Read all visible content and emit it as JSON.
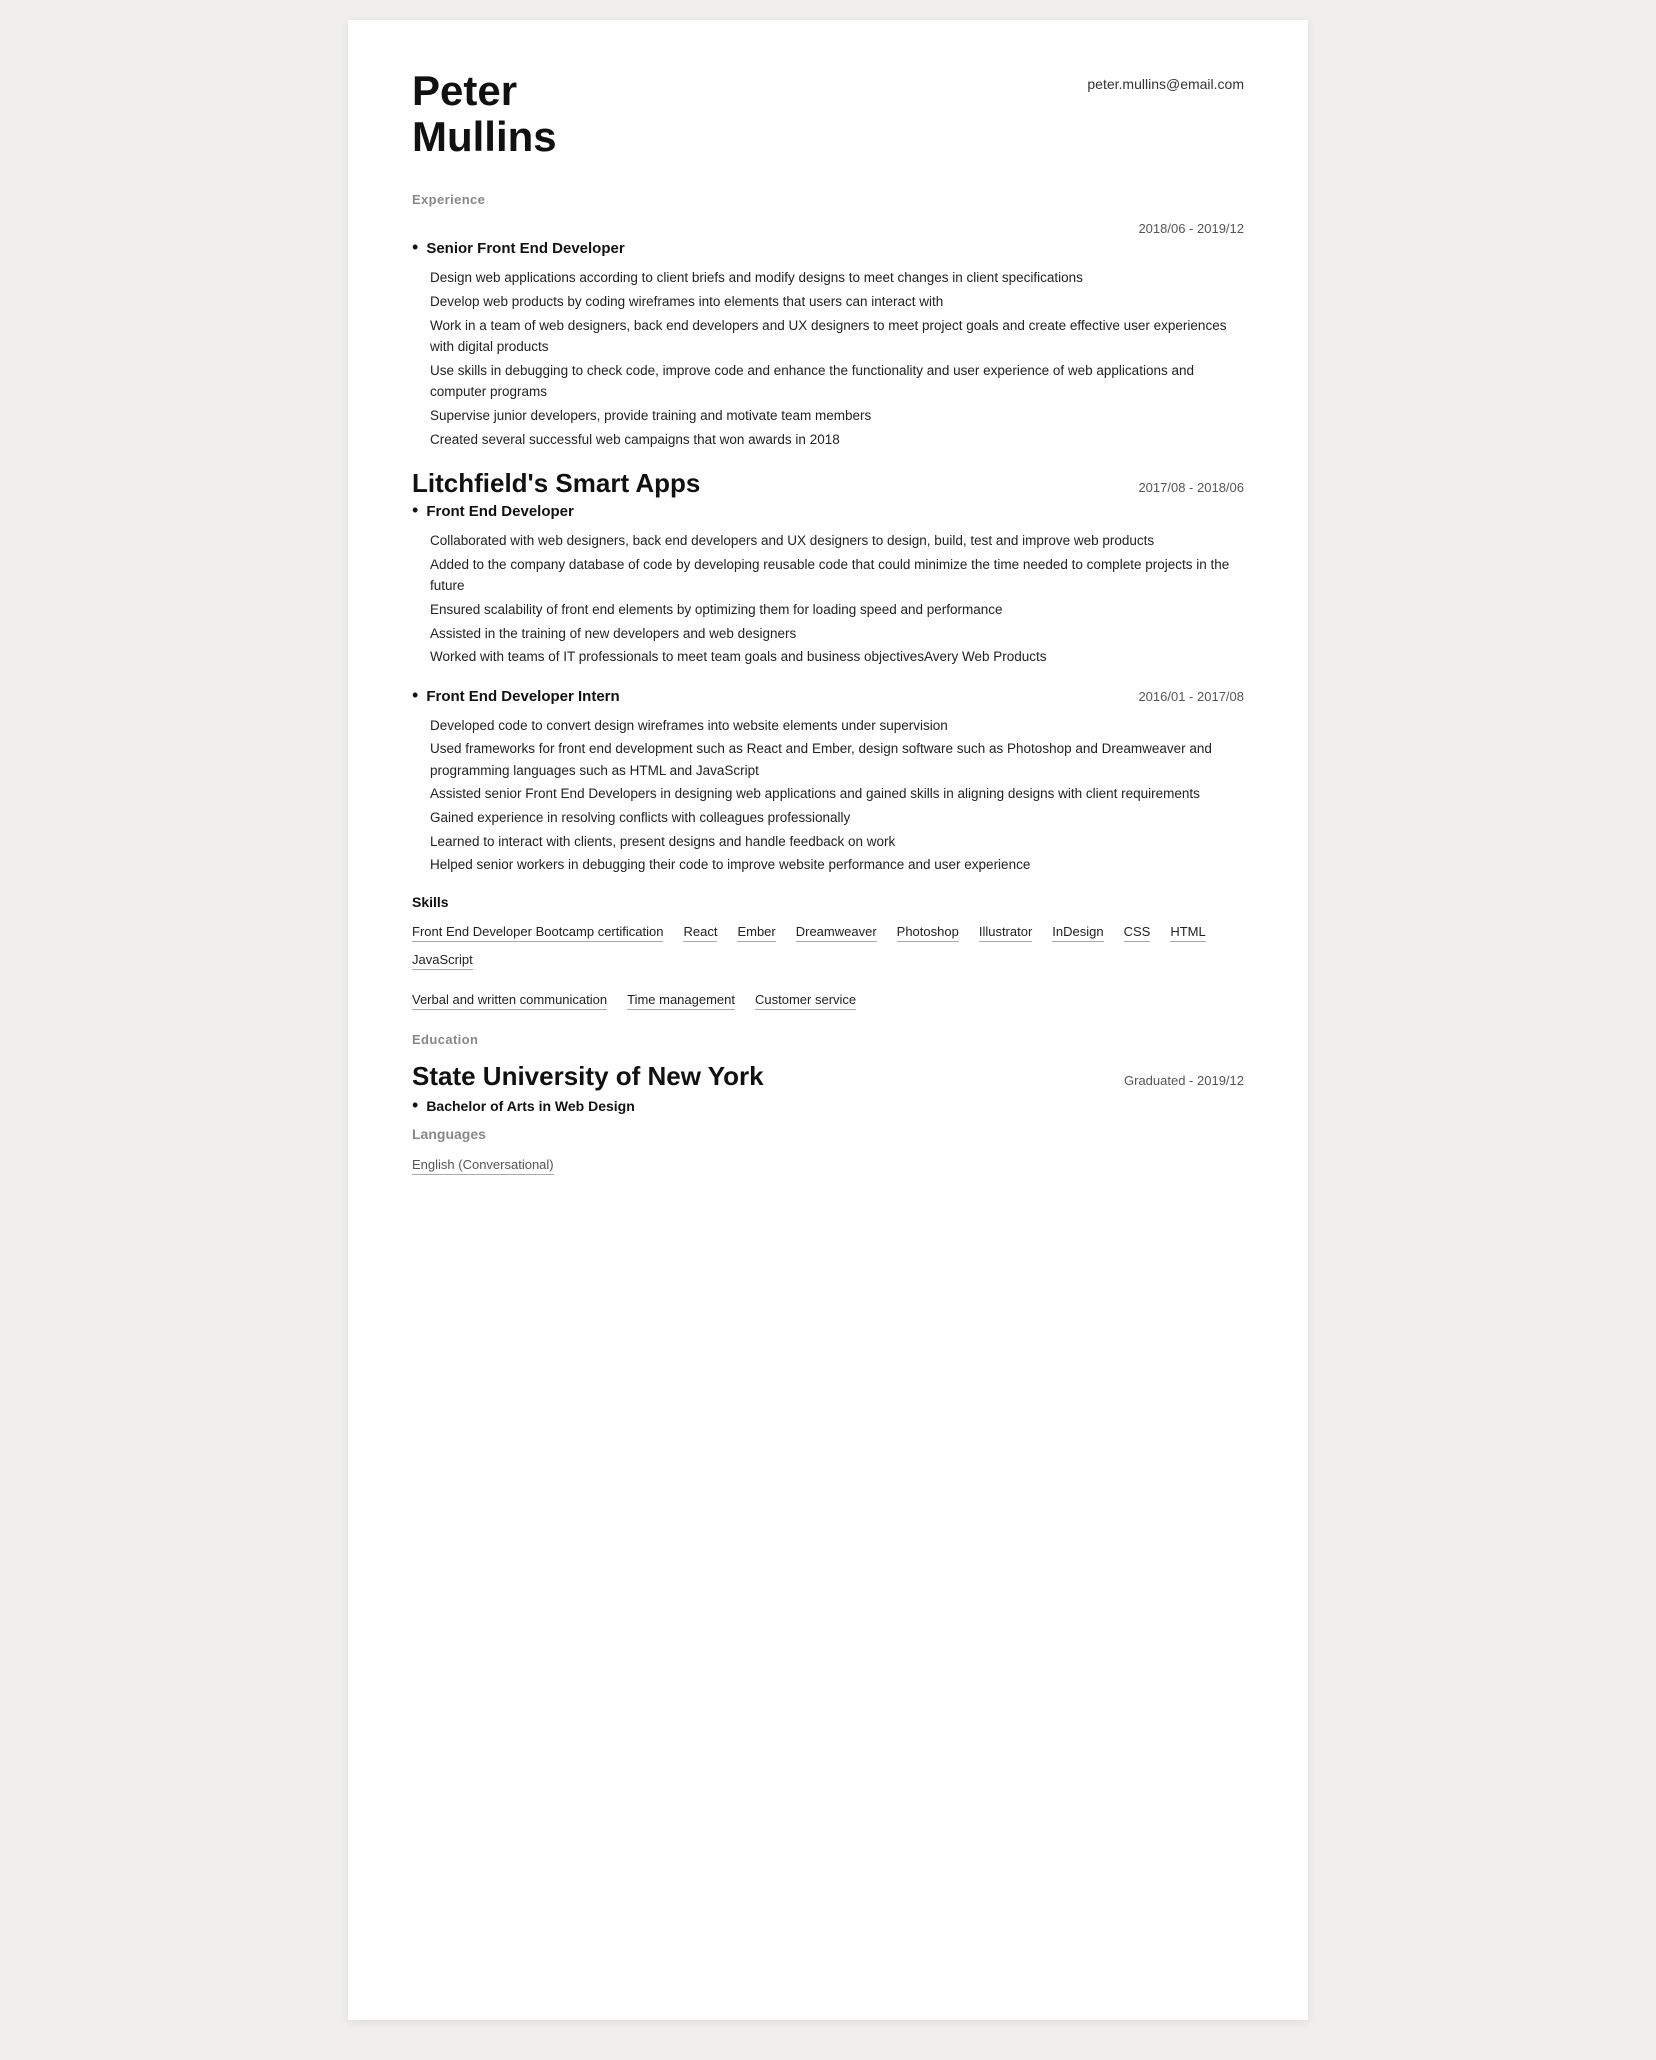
{
  "header": {
    "name_line1": "Peter",
    "name_line2": "Mullins",
    "email": "peter.mullins@email.com"
  },
  "sections": {
    "experience_label": "Experience",
    "education_label": "Education",
    "skills_label": "Skills",
    "languages_label": "Languages"
  },
  "jobs": [
    {
      "company": "",
      "title": "Senior Front End Developer",
      "date": "2018/06 - 2019/12",
      "bullets": [
        "Design web applications according to client briefs and modify designs to meet changes in client specifications",
        "Develop web products by coding wireframes into elements that users can interact with",
        "Work in a team of web designers, back end developers and UX designers to meet project goals and create effective user experiences with digital products",
        "Use skills in debugging to check code, improve code and enhance the functionality and user experience of web applications and computer programs",
        "Supervise junior developers, provide training and motivate team members",
        "Created several successful web campaigns that won awards in 2018"
      ]
    },
    {
      "company": "Litchfield's Smart Apps",
      "title": "Front End Developer",
      "date": "2017/08 - 2018/06",
      "bullets": [
        "Collaborated with web designers, back end developers and UX designers to design, build, test and improve web products",
        "Added to the company database of code by developing reusable code that could minimize the time needed to complete projects in the future",
        "Ensured scalability of front end elements by optimizing them for loading speed and performance",
        "Assisted in the training of new developers and web designers",
        "Worked with teams of IT professionals to meet team goals and business objectivesAvery Web Products"
      ]
    },
    {
      "company": "",
      "title": "Front End Developer Intern",
      "date": "2016/01 - 2017/08",
      "bullets": [
        "Developed code to convert design wireframes into website elements under supervision",
        "Used frameworks for front end development such as React and Ember, design software such as Photoshop and Dreamweaver and programming languages such as HTML and JavaScript",
        "Assisted senior Front End Developers in designing web applications and gained skills in aligning designs with client requirements",
        "Gained experience in resolving conflicts with colleagues professionally",
        "Learned to interact with clients, present designs and handle feedback on work",
        "Helped senior workers in debugging their code to improve website performance and user experience"
      ]
    }
  ],
  "skills_rows": [
    [
      "Front End Developer Bootcamp certification",
      "React",
      "Ember",
      "Dreamweaver",
      "Photoshop",
      "Illustrator",
      "InDesign",
      "CSS",
      "HTML",
      "JavaScript"
    ],
    [
      "Verbal and written communication",
      "Time management",
      "Customer service"
    ]
  ],
  "education": {
    "university": "State University of New York",
    "degree": "Bachelor of Arts in Web Design",
    "graduated": "Graduated - 2019/12"
  },
  "languages": [
    "English  (Conversational)"
  ]
}
